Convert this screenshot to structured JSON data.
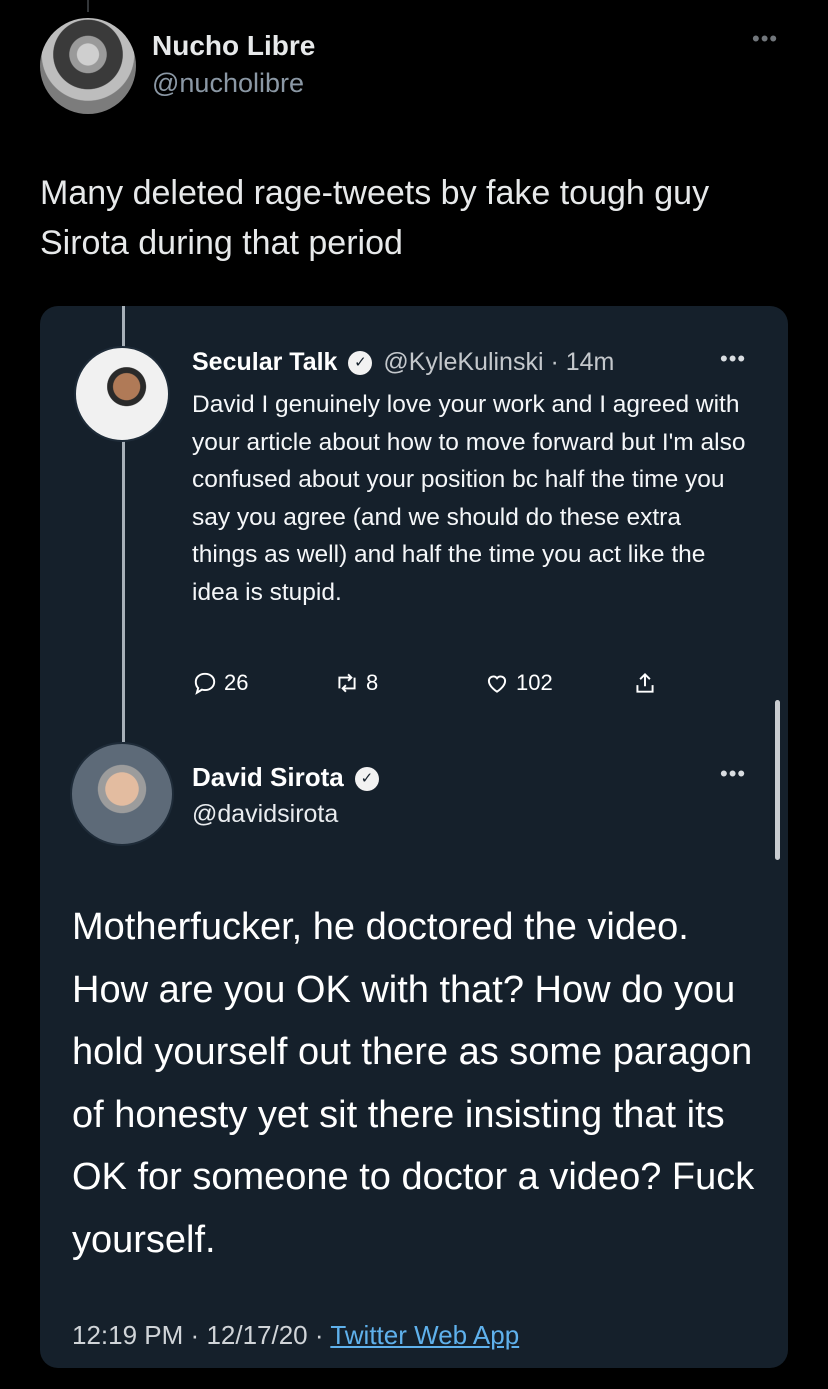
{
  "outer_tweet": {
    "display_name": "Nucho Libre",
    "handle": "@nucholibre",
    "more_icon": "more-horizontal-icon",
    "text": "Many deleted rage-tweets by fake tough guy Sirota during that period"
  },
  "quoted_tweet": {
    "display_name": "Secular Talk",
    "handle": "@KyleKulinski",
    "time": "· 14m",
    "body": "David I genuinely love your work and I agreed with your article about how to move forward but I'm also confused about your position bc half the time you say you agree (and we should do these extra things as well) and half the time you act like the idea is stupid.",
    "actions": {
      "replies": "26",
      "retweets": "8",
      "likes": "102"
    }
  },
  "reply_tweet": {
    "display_name": "David Sirota",
    "handle": "@davidsirota",
    "body": "Motherfucker, he doctored the video. How are you OK with that? How do you hold yourself out there as some paragon of honesty yet sit there insisting that its OK for someone to doctor a video? Fuck yourself.",
    "time": "12:19 PM",
    "date": "12/17/20",
    "sep1": "·",
    "sep2": "·",
    "source": "Twitter Web App"
  },
  "colors": {
    "background": "#000000",
    "card": "#15202b",
    "link": "#5fb1ec",
    "muted": "#8b98a5"
  }
}
